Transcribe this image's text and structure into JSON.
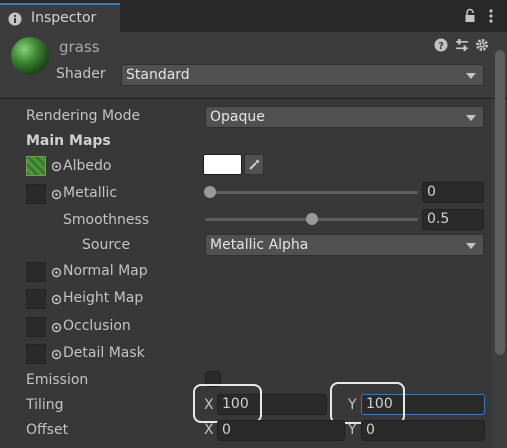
{
  "tab": {
    "title": "Inspector",
    "icon": "info-icon"
  },
  "tab_actions": [
    "lock-icon",
    "kebab-menu-icon"
  ],
  "header": {
    "material_name": "grass",
    "shader_label": "Shader",
    "shader_value": "Standard",
    "actions": [
      "help-icon",
      "preset-icon",
      "settings-icon"
    ]
  },
  "rendering": {
    "label": "Rendering Mode",
    "value": "Opaque"
  },
  "main_maps": {
    "title": "Main Maps",
    "albedo": {
      "label": "Albedo",
      "color": "#ffffff"
    },
    "metallic": {
      "label": "Metallic",
      "value": "0",
      "fraction": 0.0
    },
    "smoothness": {
      "label": "Smoothness",
      "value": "0.5",
      "fraction": 0.5
    },
    "source": {
      "label": "Source",
      "value": "Metallic Alpha"
    },
    "normal_map": "Normal Map",
    "height_map": "Height Map",
    "occlusion": "Occlusion",
    "detail_mask": "Detail Mask"
  },
  "emission": {
    "label": "Emission",
    "checked": false
  },
  "tiling": {
    "label": "Tiling",
    "x_label": "X",
    "x": "100",
    "y_label": "Y",
    "y": "100"
  },
  "offset": {
    "label": "Offset",
    "x_label": "X",
    "x": "0",
    "y_label": "Y",
    "y": "0"
  }
}
